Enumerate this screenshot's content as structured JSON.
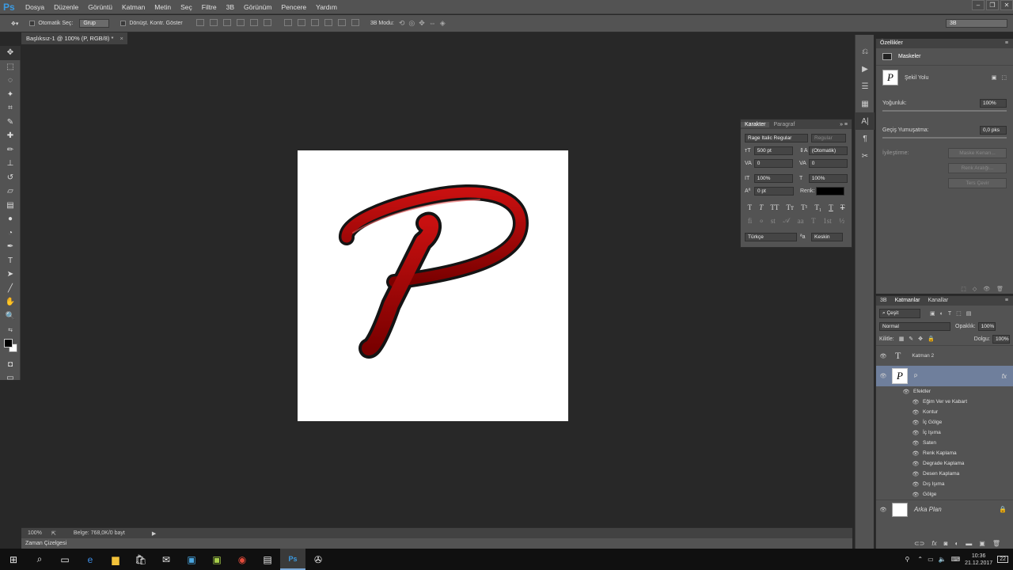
{
  "app": {
    "logo": "Ps"
  },
  "menu": [
    "Dosya",
    "Düzenle",
    "Görüntü",
    "Katman",
    "Metin",
    "Seç",
    "Filtre",
    "3B",
    "Görünüm",
    "Pencere",
    "Yardım"
  ],
  "options": {
    "auto_select_label": "Otomatik Seç:",
    "auto_select_value": "Grup",
    "transform_label": "Dönüşt. Kontr. Göster",
    "mode3d_label": "3B Modu:",
    "workspace": "3B"
  },
  "document": {
    "tab_title": "Başlıksız-1 @ 100% (P, RGB/8) *",
    "close": "×"
  },
  "status": {
    "zoom": "100%",
    "doc_info": "Belge: 768,0K/0 bayt",
    "timeline": "Zaman Çizelgesi"
  },
  "character": {
    "tabs": [
      "Karakter",
      "Paragraf"
    ],
    "font_family": "Rage Italic Regular",
    "font_style": "Regular",
    "size": "500 pt",
    "leading": "(Otomatik)",
    "kerning": "0",
    "tracking": "0",
    "vscale": "100%",
    "hscale": "100%",
    "baseline": "0 pt",
    "color_label": "Renk:",
    "language": "Türkçe",
    "antialias": "Keskin"
  },
  "properties": {
    "tab": "Özellikler",
    "section": "Maskeler",
    "mask_type": "Şekil Yolu",
    "density_label": "Yoğunluk:",
    "density_value": "100%",
    "feather_label": "Geçiş Yumuşatma:",
    "feather_value": "0,0 pks",
    "refine_label": "İyileştirme:",
    "btn_mask_edge": "Maske Kenarı...",
    "btn_color_range": "Renk Aralığı...",
    "btn_invert": "Ters Çevir"
  },
  "layers": {
    "tabs": [
      "3B",
      "Katmanlar",
      "Kanallar"
    ],
    "filter": "Çeşit",
    "blend": "Normal",
    "opacity_label": "Opaklık:",
    "opacity": "100%",
    "lock_label": "Kilitle:",
    "fill_label": "Dolgu:",
    "fill": "100%",
    "items": [
      {
        "name": "Katman 2"
      },
      {
        "name": "P",
        "fx": "fx"
      },
      {
        "name": "Arka Plan"
      }
    ],
    "effects_label": "Efektler",
    "effects": [
      "Eğim Ver ve Kabart",
      "Kontur",
      "İç Gölge",
      "İç Işıma",
      "Saten",
      "Renk Kaplama",
      "Degrade Kaplama",
      "Desen Kaplama",
      "Dış Işıma",
      "Gölge"
    ]
  },
  "taskbar": {
    "time": "10:36",
    "date": "21.12.2017",
    "notifications": "22"
  }
}
